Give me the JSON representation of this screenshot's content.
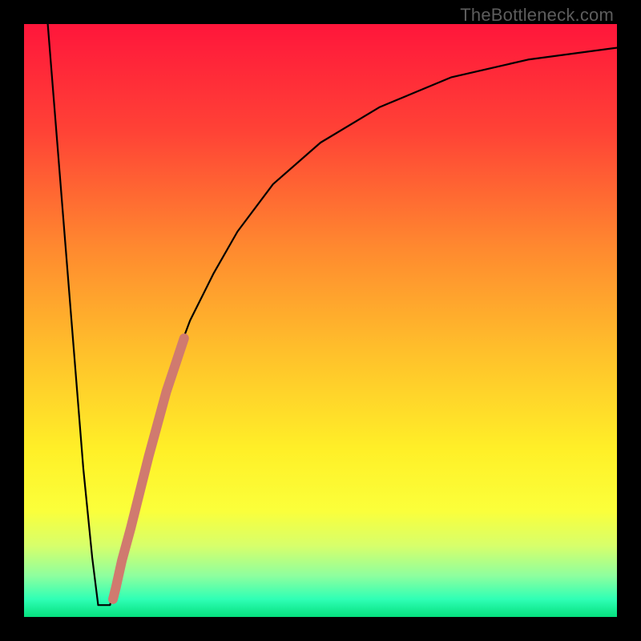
{
  "watermark": "TheBottleneck.com",
  "chart_data": {
    "type": "line",
    "title": "",
    "xlabel": "",
    "ylabel": "",
    "xlim": [
      0,
      100
    ],
    "ylim": [
      0,
      100
    ],
    "grid": false,
    "legend": false,
    "curve": {
      "description": "Bottleneck percentage curve — sharp V near x≈13 rising toward 100 on the right",
      "points": [
        {
          "x": 4.0,
          "y": 100.0
        },
        {
          "x": 6.0,
          "y": 75.0
        },
        {
          "x": 8.0,
          "y": 50.0
        },
        {
          "x": 10.0,
          "y": 25.0
        },
        {
          "x": 11.5,
          "y": 10.0
        },
        {
          "x": 12.5,
          "y": 2.0
        },
        {
          "x": 14.5,
          "y": 2.0
        },
        {
          "x": 16.0,
          "y": 8.0
        },
        {
          "x": 18.0,
          "y": 16.0
        },
        {
          "x": 20.0,
          "y": 24.0
        },
        {
          "x": 22.0,
          "y": 32.0
        },
        {
          "x": 25.0,
          "y": 42.0
        },
        {
          "x": 28.0,
          "y": 50.0
        },
        {
          "x": 32.0,
          "y": 58.0
        },
        {
          "x": 36.0,
          "y": 65.0
        },
        {
          "x": 42.0,
          "y": 73.0
        },
        {
          "x": 50.0,
          "y": 80.0
        },
        {
          "x": 60.0,
          "y": 86.0
        },
        {
          "x": 72.0,
          "y": 91.0
        },
        {
          "x": 85.0,
          "y": 94.0
        },
        {
          "x": 100.0,
          "y": 96.0
        }
      ]
    },
    "highlighted_segment": {
      "description": "Thick salmon band overlaid on the rising edge of the V",
      "color": "#d07a6f",
      "thickness_px": 12,
      "points": [
        {
          "x": 15.0,
          "y": 3.0
        },
        {
          "x": 15.5,
          "y": 5.0
        },
        {
          "x": 16.5,
          "y": 9.5
        },
        {
          "x": 18.0,
          "y": 15.0
        },
        {
          "x": 19.5,
          "y": 21.0
        },
        {
          "x": 21.0,
          "y": 27.0
        },
        {
          "x": 22.5,
          "y": 32.5
        },
        {
          "x": 24.0,
          "y": 38.0
        },
        {
          "x": 25.5,
          "y": 42.5
        },
        {
          "x": 27.0,
          "y": 47.0
        }
      ]
    },
    "dots": {
      "color": "#d07a6f",
      "radius_px": 5,
      "points": [
        {
          "x": 15.0,
          "y": 3.0
        },
        {
          "x": 16.5,
          "y": 9.5
        },
        {
          "x": 17.6,
          "y": 13.8
        }
      ]
    },
    "background_gradient": {
      "type": "vertical",
      "stops": [
        {
          "pos": 0.0,
          "color": "#ff163b"
        },
        {
          "pos": 0.18,
          "color": "#ff4236"
        },
        {
          "pos": 0.38,
          "color": "#ff8a2f"
        },
        {
          "pos": 0.55,
          "color": "#ffbf2b"
        },
        {
          "pos": 0.72,
          "color": "#fff028"
        },
        {
          "pos": 0.82,
          "color": "#fbff3a"
        },
        {
          "pos": 0.88,
          "color": "#d7ff6b"
        },
        {
          "pos": 0.93,
          "color": "#8fff9e"
        },
        {
          "pos": 0.97,
          "color": "#2fffb5"
        },
        {
          "pos": 1.0,
          "color": "#05e07e"
        }
      ]
    }
  }
}
